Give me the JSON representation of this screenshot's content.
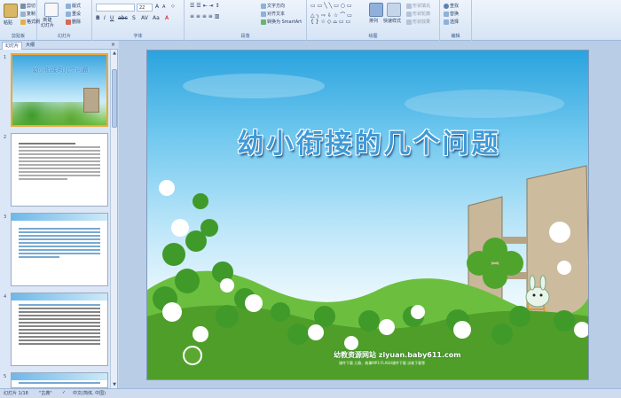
{
  "ribbon": {
    "clipboard": {
      "paste": "粘贴",
      "cut": "剪切",
      "copy": "复制",
      "format_painter": "格式刷",
      "label": "剪贴板"
    },
    "slides": {
      "new_slide": "新建\n幻灯片",
      "layout": "版式",
      "reset": "重设",
      "delete": "删除",
      "label": "幻灯片"
    },
    "font": {
      "font_name": "",
      "font_size": "22",
      "label": "字体"
    },
    "paragraph": {
      "text_direction": "文字方向",
      "align_text": "对齐文本",
      "convert_smartart": "转换为 SmartArt",
      "label": "段落"
    },
    "drawing": {
      "arrange": "排列",
      "quick_styles": "快速样式",
      "shape_fill": "形状填充",
      "shape_outline": "形状轮廓",
      "shape_effects": "形状效果",
      "label": "绘图"
    },
    "editing": {
      "find": "查找",
      "replace": "替换",
      "select": "选择",
      "label": "编辑"
    }
  },
  "panel": {
    "tabs": [
      "幻灯片",
      "大纲"
    ],
    "close": "×",
    "thumbs": [
      {
        "num": "1",
        "title": "幼小衔接的几个问题"
      },
      {
        "num": "2",
        "title": ""
      },
      {
        "num": "3",
        "title": ""
      },
      {
        "num": "4",
        "title": ""
      },
      {
        "num": "5",
        "title": ""
      }
    ]
  },
  "slide": {
    "title": "幼小衔接的几个问题",
    "site_name": "幼教资源网站  ziyuan.baby611.com",
    "site_sub": "课件下载  儿歌、故事MP3  FLASH课件下载  试卷下载等"
  },
  "status": {
    "slide_count": "幻灯片 1/18",
    "theme": "\"古典\"",
    "language": "中文(简体, 中国)"
  },
  "colors": {
    "ribbon_bg": "#dfe9f7",
    "title_fill": "#3f9ad8",
    "grass": "#5aa832",
    "selected_border": "#f0a830"
  }
}
